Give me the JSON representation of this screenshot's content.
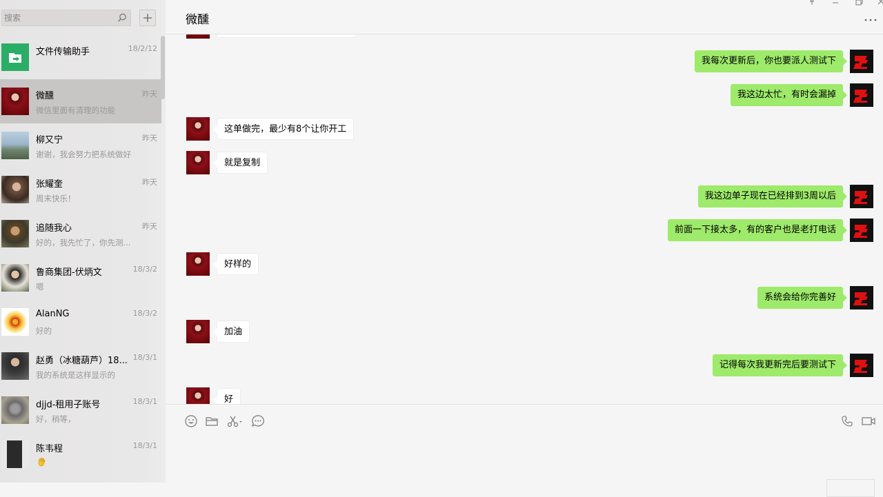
{
  "search": {
    "placeholder": "搜索"
  },
  "conversations": [
    {
      "name": "文件传输助手",
      "time": "18/2/12",
      "preview": ""
    },
    {
      "name": "微醺",
      "time": "昨天",
      "preview": "微信里面有清理的功能"
    },
    {
      "name": "柳又宁",
      "time": "昨天",
      "preview": "谢谢，我会努力把系统做好"
    },
    {
      "name": "张耀奎",
      "time": "昨天",
      "preview": "周末快乐！"
    },
    {
      "name": "追随我心",
      "time": "昨天",
      "preview": "好的，我先忙了，你先测..."
    },
    {
      "name": "鲁商集团-伏炳文",
      "time": "18/3/2",
      "preview": "嗯"
    },
    {
      "name": "AlanNG",
      "time": "18/3/2",
      "preview": "好的"
    },
    {
      "name": "赵勇（冰糖葫芦）18...",
      "time": "18/3/1",
      "preview": "我的系统是这样显示的"
    },
    {
      "name": "djjd-租用子账号",
      "time": "18/3/1",
      "preview": "好，稍等，"
    },
    {
      "name": "陈韦程",
      "time": "18/3/1",
      "preview": ""
    }
  ],
  "chat": {
    "title": "微醺",
    "messages": [
      {
        "side": "right",
        "text": "我每次更新后，你也要派人测试下"
      },
      {
        "side": "right",
        "text": "我这边太忙，有时会漏掉"
      },
      {
        "side": "left",
        "text": "这单做完，最少有8个让你开工"
      },
      {
        "side": "left",
        "text": "就是复制"
      },
      {
        "side": "right",
        "text": "我这边单子现在已经排到3周以后"
      },
      {
        "side": "right",
        "text": "前面一下接太多，有的客户也是老打电话"
      },
      {
        "side": "left",
        "text": "好样的"
      },
      {
        "side": "right",
        "text": "系统会给你完善好"
      },
      {
        "side": "left",
        "text": "加油"
      },
      {
        "side": "right",
        "text": "记得每次我更新完后要测试下"
      },
      {
        "side": "left",
        "text": "好"
      }
    ]
  },
  "colors": {
    "sent_bubble": "#9eea6a",
    "received_bubble": "#ffffff",
    "selected_conversation": "#c7c6c5",
    "file_helper_green": "#2aae67"
  },
  "icons": {
    "toolbar": [
      "emoji-icon",
      "folder-icon",
      "scissors-icon",
      "chat-history-icon"
    ],
    "call": [
      "phone-icon",
      "video-call-icon"
    ],
    "window": [
      "pin-icon",
      "minimize-icon",
      "maximize-icon",
      "close-icon"
    ]
  }
}
